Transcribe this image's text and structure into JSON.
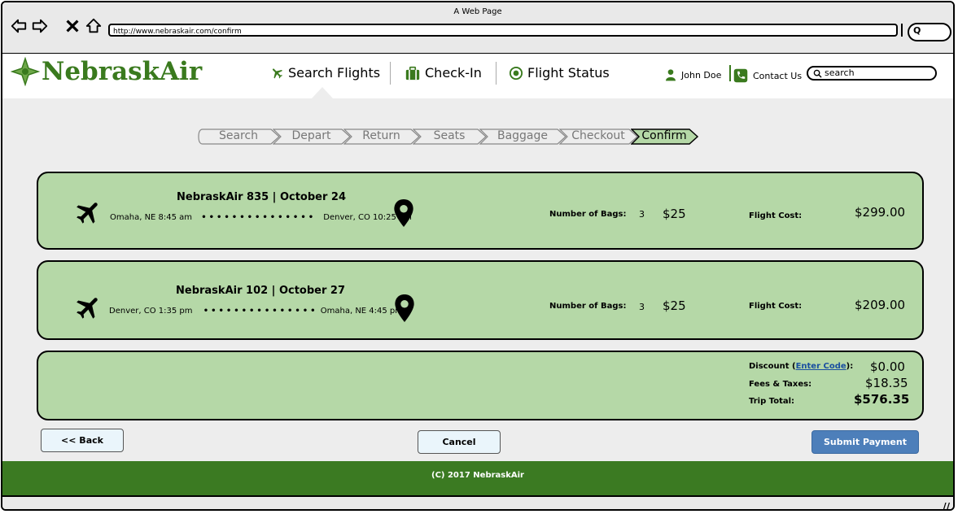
{
  "window": {
    "title": "A Web Page",
    "url": "http://www.nebraskair.com/confirm"
  },
  "site": {
    "logo": "NebraskAir",
    "nav": {
      "search_flights": "Search Flights",
      "check_in": "Check-In",
      "flight_status": "Flight Status"
    },
    "user": "John Doe",
    "contact": "Contact Us",
    "search_placeholder": "search"
  },
  "steps": [
    "Search",
    "Depart",
    "Return",
    "Seats",
    "Baggage",
    "Checkout",
    "Confirm"
  ],
  "flights": [
    {
      "title": "NebraskAir 835 | October 24",
      "from": "Omaha, NE 8:45 am",
      "dots": "•••••••••••••••",
      "to": "Denver, CO 10:25 am",
      "bags_label": "Number of Bags:",
      "bags": "3",
      "bag_cost": "$25",
      "cost_label": "Flight Cost:",
      "cost": "$299.00"
    },
    {
      "title": "NebraskAir 102 | October 27",
      "from": "Denver, CO 1:35 pm",
      "dots": "•••••••••••••••",
      "to": "Omaha, NE 4:45 pm",
      "bags_label": "Number of Bags:",
      "bags": "3",
      "bag_cost": "$25",
      "cost_label": "Flight Cost:",
      "cost": "$209.00"
    }
  ],
  "summary": {
    "discount_label": "Discount (",
    "enter_code": "Enter Code",
    "discount_suffix": "):",
    "discount": "$0.00",
    "fees_label": "Fees & Taxes:",
    "fees": "$18.35",
    "total_label": "Trip Total:",
    "total": "$576.35"
  },
  "buttons": {
    "back": "<< Back",
    "cancel": "Cancel",
    "submit": "Submit Payment"
  },
  "footer": "(C) 2017 NebraskAir",
  "colors": {
    "brand": "#3a7a1e",
    "card": "#b5d8a7",
    "footer": "#3b7a22",
    "primary": "#4d7fba"
  }
}
